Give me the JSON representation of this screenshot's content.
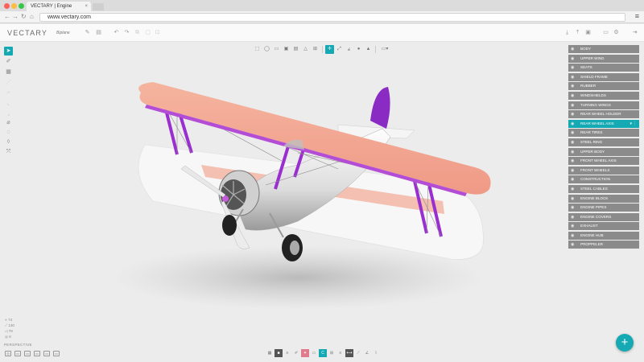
{
  "browser": {
    "tab_title": "VECTARY | Engine",
    "tab_close": "×",
    "url": "www.vectary.com",
    "back": "←",
    "forward": "→",
    "reload": "↻",
    "home": "⌂",
    "menu": "≡"
  },
  "app": {
    "logo": "VECTARY",
    "project_name": "Biplane",
    "accent_color": "#14a9b3"
  },
  "layers": [
    {
      "label": "BODY"
    },
    {
      "label": "UPPER WING"
    },
    {
      "label": "SEATS"
    },
    {
      "label": "SHIELD FRAME"
    },
    {
      "label": "RUBBER"
    },
    {
      "label": "WINDSHIELDS"
    },
    {
      "label": "TURNING WINGS"
    },
    {
      "label": "REAR WHEEL HOLDER"
    },
    {
      "label": "REAR WHEEL AXIS",
      "active": true
    },
    {
      "label": "REAR TIRES"
    },
    {
      "label": "STEEL RING"
    },
    {
      "label": "UPPER BODY"
    },
    {
      "label": "FRONT WHEEL AXIS"
    },
    {
      "label": "FRONT WHEELS"
    },
    {
      "label": "CONSTRUCTION"
    },
    {
      "label": "STEEL CABLES"
    },
    {
      "label": "ENGINE BLOCK"
    },
    {
      "label": "ENGINE PIPES"
    },
    {
      "label": "ENGINE COVERS"
    },
    {
      "label": "EXHAUST"
    },
    {
      "label": "ENGINE HUB"
    },
    {
      "label": "PROPPELER"
    }
  ],
  "stats": {
    "vertices": "74",
    "edges": "130",
    "faces": "78",
    "objects": "8"
  },
  "viewport": {
    "camera_label": "PERSPECTIVE"
  },
  "fab_label": "+"
}
